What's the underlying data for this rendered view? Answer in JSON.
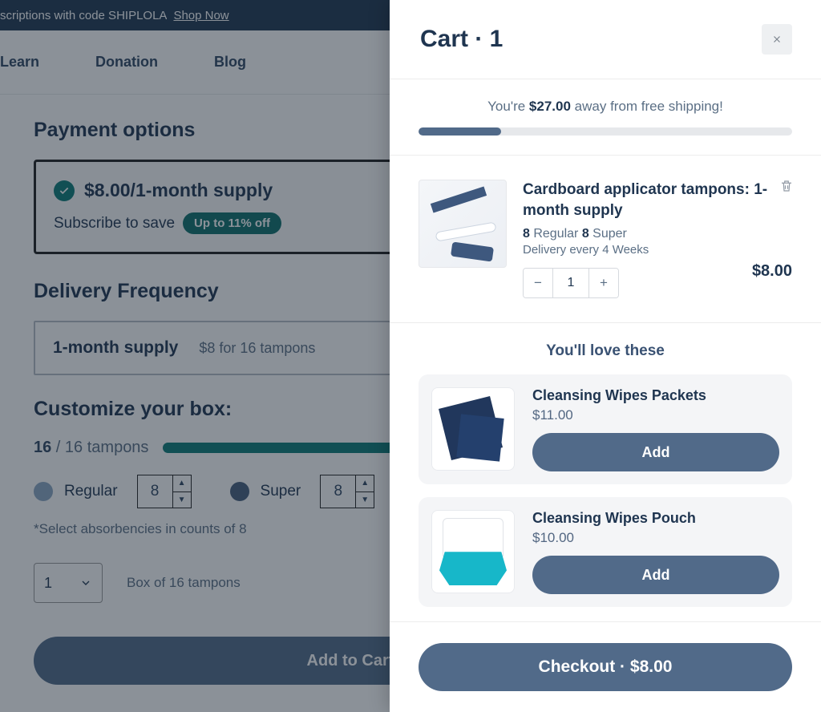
{
  "promo": {
    "text": "scriptions with code SHIPLOLA",
    "cta": "Shop Now"
  },
  "nav": {
    "learn": "Learn",
    "donation": "Donation",
    "blog": "Blog"
  },
  "payment": {
    "heading": "Payment options",
    "price_line": "$8.00/1-month supply",
    "subscribe": "Subscribe to save",
    "badge": "Up to 11% off"
  },
  "frequency": {
    "heading": "Delivery Frequency",
    "title": "1-month supply",
    "subtitle": "$8 for 16 tampons"
  },
  "customize": {
    "heading": "Customize your box:",
    "count_current": "16",
    "count_sep": " / ",
    "count_total": "16 tampons",
    "regular_label": "Regular",
    "regular_val": "8",
    "super_label": "Super",
    "super_val": "8",
    "note": "*Select absorbencies in counts of 8",
    "qty": "1",
    "box_hint": "Box of 16 tampons",
    "add_to_cart": "Add to Cart"
  },
  "cart": {
    "title": "Cart · 1",
    "ship_prefix": "You're ",
    "ship_amount": "$27.00",
    "ship_suffix": " away from free shipping!",
    "ship_pct": 22,
    "item": {
      "name": "Cardboard applicator tampons: 1-month supply",
      "var_reg_n": "8",
      "var_reg_l": " Regular  ",
      "var_sup_n": "8",
      "var_sup_l": " Super",
      "delivery": "Delivery every 4 Weeks",
      "qty": "1",
      "price": "$8.00"
    },
    "love_heading": "You'll love these",
    "rec1": {
      "name": "Cleansing Wipes Packets",
      "price": "$11.00",
      "btn": "Add"
    },
    "rec2": {
      "name": "Cleansing Wipes Pouch",
      "price": "$10.00",
      "btn": "Add"
    },
    "checkout": "Checkout · $8.00"
  }
}
